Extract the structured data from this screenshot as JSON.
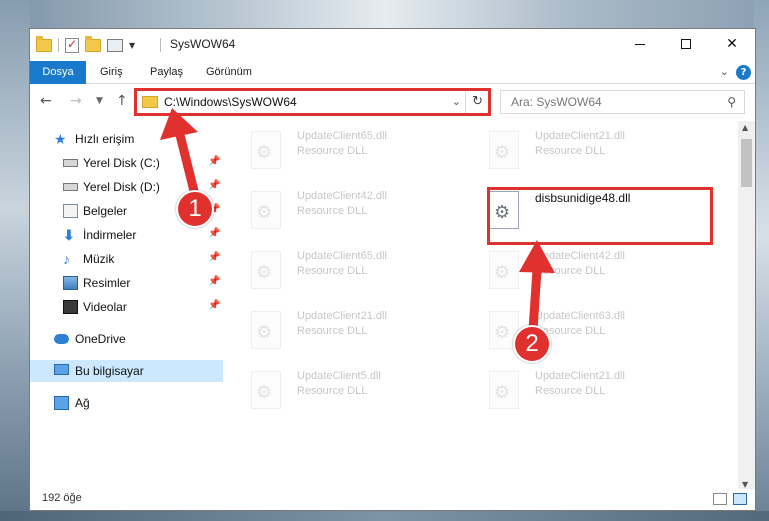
{
  "window": {
    "title": "SysWOW64"
  },
  "ribbon": {
    "tabs": [
      "Dosya",
      "Giriş",
      "Paylaş",
      "Görünüm"
    ],
    "help": "?"
  },
  "navigation": {
    "address": "C:\\Windows\\SysWOW64",
    "search_placeholder": "Ara: SysWOW64"
  },
  "sidebar": {
    "items": [
      {
        "label": "Hızlı erişim",
        "icon": "star-icon"
      },
      {
        "label": "Yerel Disk (C:)",
        "icon": "drive-icon",
        "pinned": true
      },
      {
        "label": "Yerel Disk (D:)",
        "icon": "drive-icon",
        "pinned": true
      },
      {
        "label": "Belgeler",
        "icon": "documents-icon",
        "pinned": true
      },
      {
        "label": "İndirmeler",
        "icon": "downloads-icon",
        "pinned": true
      },
      {
        "label": "Müzik",
        "icon": "music-icon",
        "pinned": true
      },
      {
        "label": "Resimler",
        "icon": "pictures-icon",
        "pinned": true
      },
      {
        "label": "Videolar",
        "icon": "videos-icon",
        "pinned": true
      },
      {
        "label": "OneDrive",
        "icon": "onedrive-icon"
      },
      {
        "label": "Bu bilgisayar",
        "icon": "computer-icon",
        "selected": true
      },
      {
        "label": "Ağ",
        "icon": "network-icon"
      }
    ]
  },
  "files": [
    {
      "name": "UpdateClient65.dll",
      "type": "Resource DLL"
    },
    {
      "name": "UpdateClient21.dll",
      "type": "Resource DLL"
    },
    {
      "name": "UpdateClient42.dll",
      "type": "Resource DLL"
    },
    {
      "name": "disbsunidige48.dll",
      "type": ""
    },
    {
      "name": "UpdateClient65.dll",
      "type": "Resource DLL"
    },
    {
      "name": "UpdateClient42.dll",
      "type": "Resource DLL"
    },
    {
      "name": "UpdateClient21.dll",
      "type": "Resource DLL"
    },
    {
      "name": "UpdateClient63.dll",
      "type": "Resource DLL"
    },
    {
      "name": "UpdateClient5.dll",
      "type": "Resource DLL"
    },
    {
      "name": "UpdateClient21.dll",
      "type": "Resource DLL"
    }
  ],
  "status": {
    "item_count": "192 öğe"
  },
  "annotations": {
    "step1": "1",
    "step2": "2",
    "highlight_color": "#e0312e"
  },
  "colors": {
    "accent": "#1979ca",
    "selection": "#cce8ff"
  }
}
